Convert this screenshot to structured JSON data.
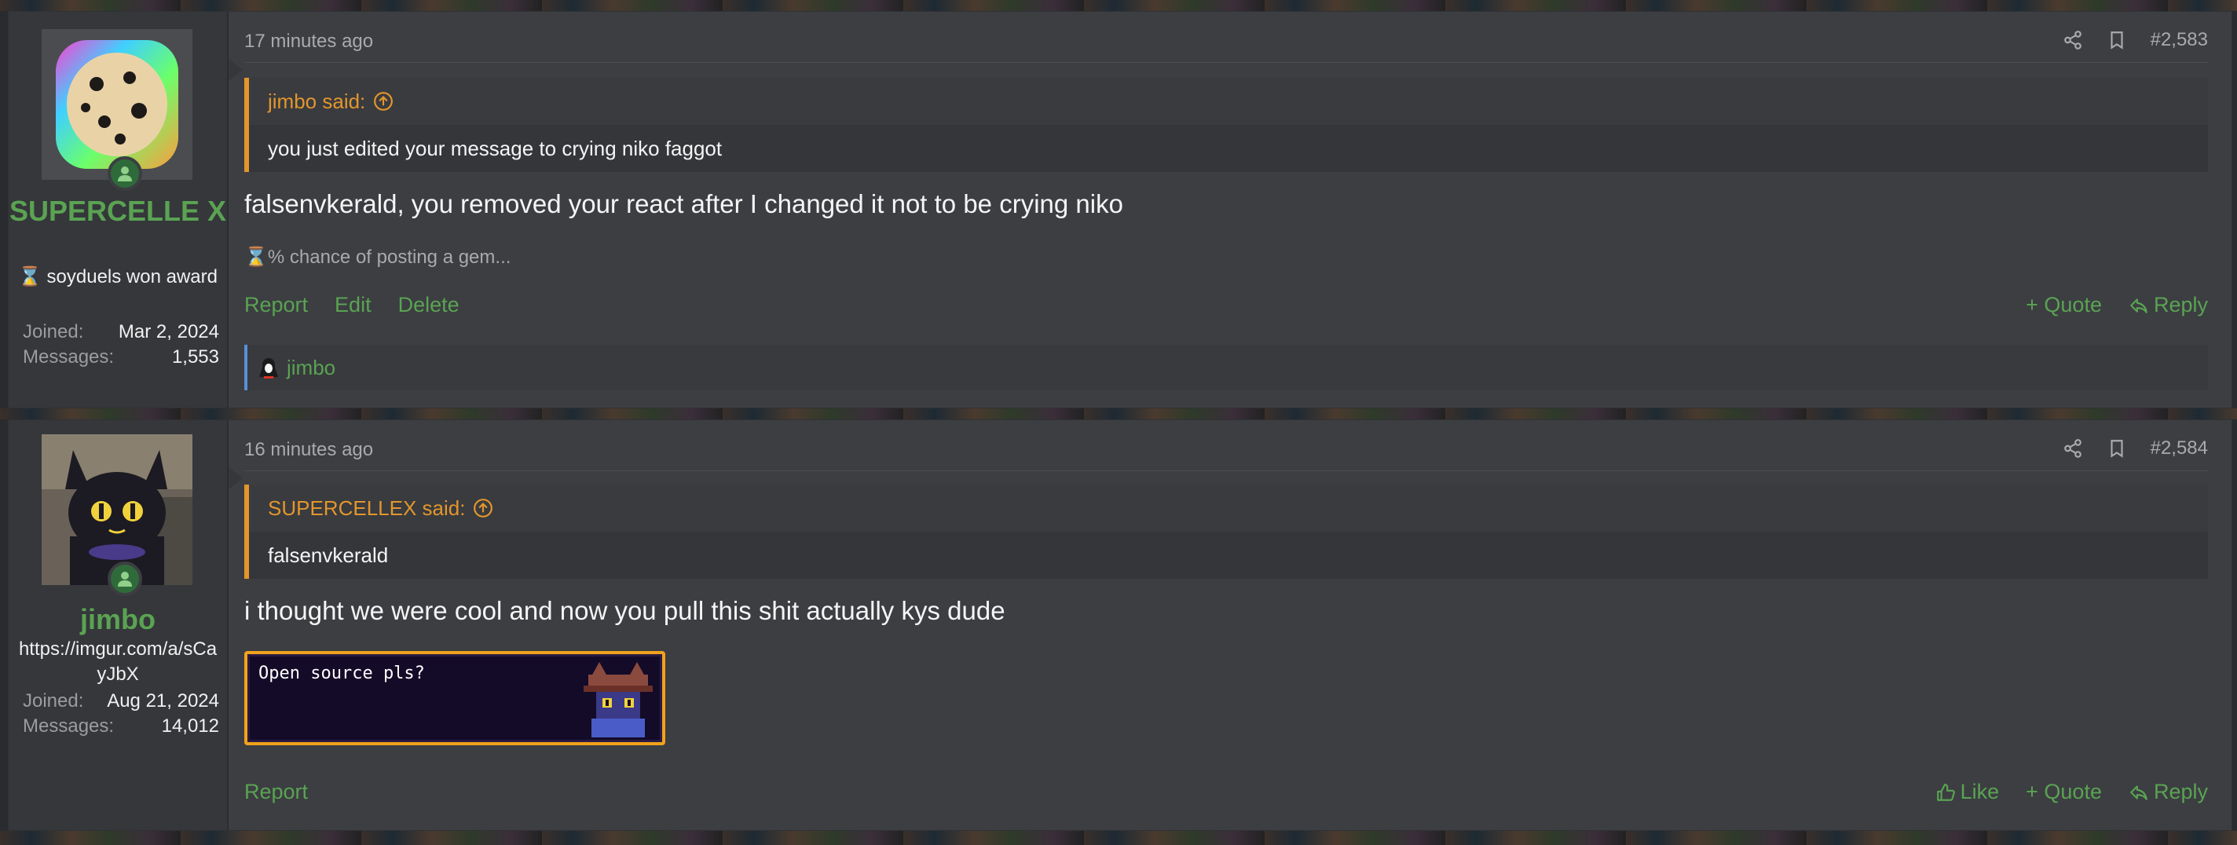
{
  "posts": [
    {
      "username": "SUPERCELLE X",
      "user_title": "⌛ soyduels won award",
      "joined_label": "Joined:",
      "joined": "Mar 2, 2024",
      "messages_label": "Messages:",
      "messages": "1,553",
      "time": "17 minutes ago",
      "post_number": "#2,583",
      "quote_author": "jimbo said:",
      "quote_text": "you just edited your message to crying niko faggot",
      "message": "falsenvkerald, you removed your react after I changed it not to be crying niko",
      "signature": "⌛% chance of posting a gem...",
      "actions_left": [
        "Report",
        "Edit",
        "Delete"
      ],
      "quote_label": "+ Quote",
      "reply_label": "Reply",
      "reaction_user": "jimbo"
    },
    {
      "username": "jimbo",
      "user_title": "https://imgur.com/a/sCayJbX",
      "joined_label": "Joined:",
      "joined": "Aug 21, 2024",
      "messages_label": "Messages:",
      "messages": "14,012",
      "time": "16 minutes ago",
      "post_number": "#2,584",
      "quote_author": "SUPERCELLEX said:",
      "quote_text": "falsenvkerald",
      "message": "i thought we were cool and now you pull this shit actually kys dude",
      "embed_text": "Open source pls?",
      "actions_left": [
        "Report"
      ],
      "like_label": "Like",
      "quote_label": "+ Quote",
      "reply_label": "Reply"
    }
  ],
  "colors": {
    "accent_green": "#5aa352",
    "quote_orange": "#e3962c",
    "reaction_blue": "#5b8fd6"
  }
}
